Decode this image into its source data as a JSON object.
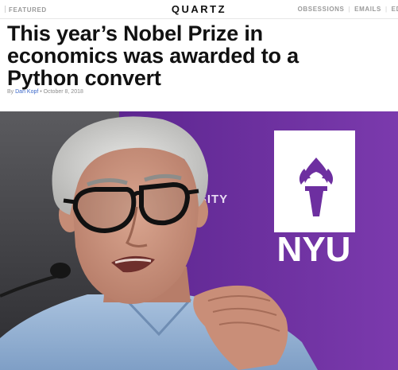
{
  "header": {
    "section": "FEATURED",
    "logo": "QUARTZ",
    "nav": [
      "OBSESSIONS",
      "EMAILS",
      "ED"
    ]
  },
  "article": {
    "headline_lines": [
      "This year’s Nobel Prize in",
      "economics was awarded to a",
      "Python convert"
    ],
    "by_prefix": "By",
    "author": "Dan Kopf",
    "separator": "•",
    "date": "October 8, 2018"
  },
  "photo": {
    "banner_text_partial": "RSITY",
    "banner_logo_text": "NYU"
  },
  "colors": {
    "accent_link": "#3a67c9",
    "nyu_purple": "#6d2fa0"
  }
}
